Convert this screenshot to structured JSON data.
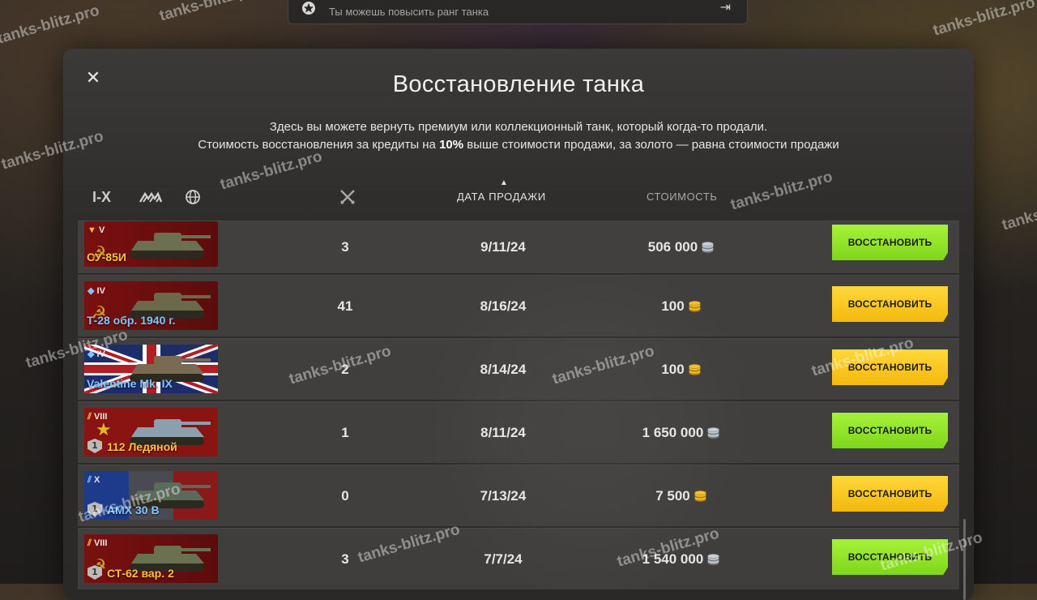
{
  "banner": {
    "text": "Ты можешь повысить ранг танка"
  },
  "modal": {
    "title": "Восстановление танка",
    "description_line1": "Здесь вы можете вернуть премиум или коллекционный танк, который когда-то продали.",
    "description_line2_pre": "Стоимость восстановления за кредиты на ",
    "description_line2_bold": "10%",
    "description_line2_post": " выше стоимости продажи, за золото — равна стоимости продажи"
  },
  "filters": {
    "tier_label": "I-X"
  },
  "columns": {
    "date": "ДАТА ПРОДАЖИ",
    "cost": "СТОИМОСТЬ"
  },
  "rows": [
    {
      "tier": "V",
      "name": "СУ-85И",
      "battles": "3",
      "date": "9/11/24",
      "cost": "506 000",
      "currency": "credits",
      "button": "ВОССТАНОВИТЬ",
      "name_color": "#f5c242",
      "flag": "ussr",
      "tier_icon": "▼"
    },
    {
      "tier": "IV",
      "name": "Т-28 обр. 1940 г.",
      "battles": "41",
      "date": "8/16/24",
      "cost": "100",
      "currency": "gold",
      "button": "ВОССТАНОВИТЬ",
      "name_color": "#7fc6ff",
      "flag": "ussr",
      "tier_icon": "◆"
    },
    {
      "tier": "IV",
      "name": "Valentine Mk. IX",
      "battles": "2",
      "date": "8/14/24",
      "cost": "100",
      "currency": "gold",
      "button": "ВОССТАНОВИТЬ",
      "name_color": "#7fc6ff",
      "flag": "uk",
      "tier_icon": "◆"
    },
    {
      "tier": "VIII",
      "name": "112 Ледяной",
      "battles": "1",
      "date": "8/11/24",
      "cost": "1 650 000",
      "currency": "credits",
      "button": "ВОССТАНОВИТЬ",
      "name_color": "#f5c242",
      "flag": "china",
      "tier_icon": "⫽",
      "mastery": "1"
    },
    {
      "tier": "X",
      "name": "AMX 30 B",
      "battles": "0",
      "date": "7/13/24",
      "cost": "7 500",
      "currency": "gold",
      "button": "ВОССТАНОВИТЬ",
      "name_color": "#7fc6ff",
      "flag": "france",
      "tier_icon": "⫽",
      "mastery": "1"
    },
    {
      "tier": "VIII",
      "name": "СТ-62 вар. 2",
      "battles": "3",
      "date": "7/7/24",
      "cost": "1 540 000",
      "currency": "credits",
      "button": "ВОССТАНОВИТЬ",
      "name_color": "#f5c242",
      "flag": "ussr",
      "tier_icon": "⫽",
      "mastery": "1"
    }
  ],
  "watermark": "tanks-blitz.pro",
  "colors": {
    "credits_button": "#8fe02a",
    "gold_button": "#f9c41e",
    "premium_name": "#f5c242",
    "collector_name": "#7fc6ff"
  }
}
